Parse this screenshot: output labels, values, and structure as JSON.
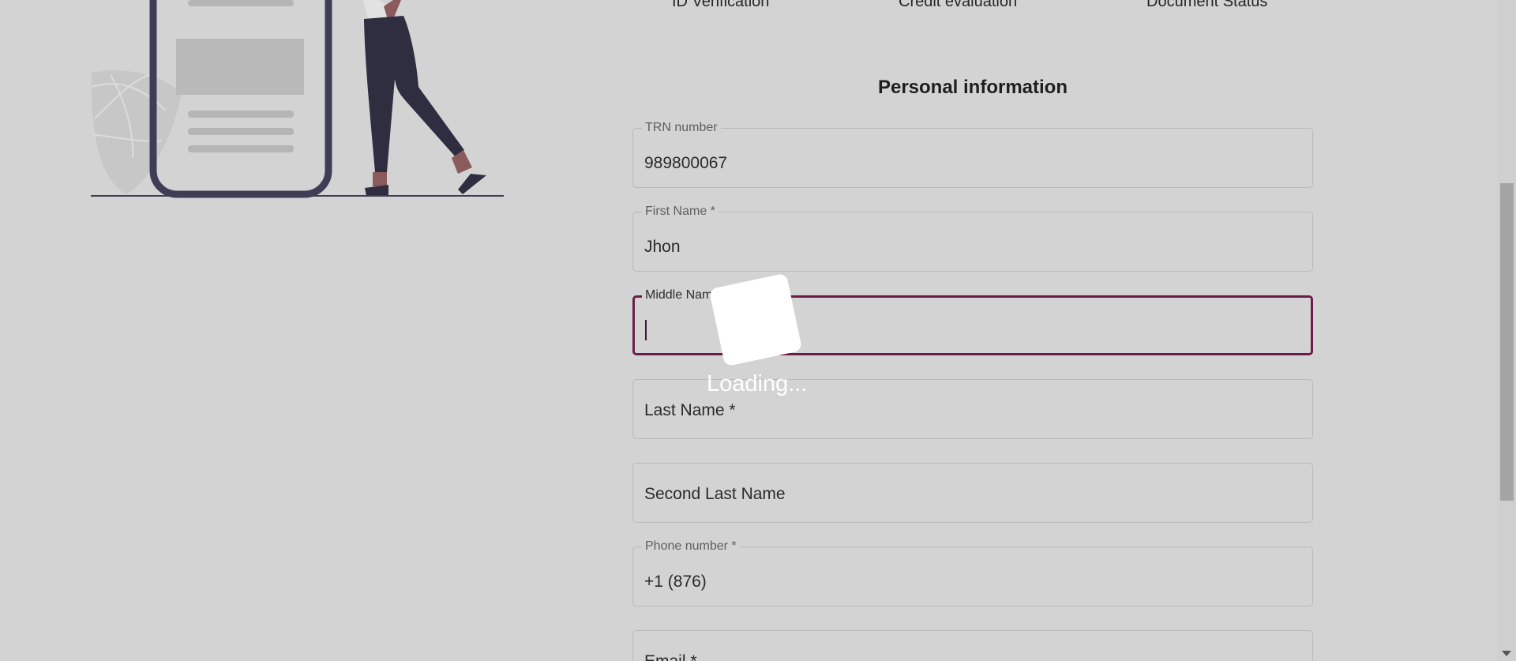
{
  "steps": {
    "id_verification": "ID Verification",
    "credit_evaluation": "Credit evaluation",
    "document_status": "Document Status"
  },
  "form": {
    "title": "Personal information",
    "trn": {
      "label": "TRN number",
      "value": "989800067"
    },
    "first_name": {
      "label": "First Name *",
      "value": "Jhon"
    },
    "middle_name": {
      "label": "Middle Name",
      "value": ""
    },
    "last_name": {
      "placeholder": "Last Name *"
    },
    "second_last_name": {
      "placeholder": "Second Last Name"
    },
    "phone": {
      "label": "Phone number *",
      "value": "+1 (876)"
    },
    "email": {
      "placeholder": "Email *"
    }
  },
  "loading": {
    "text": "Loading..."
  },
  "colors": {
    "background": "#d3d3d3",
    "focus_border": "#6b1d4a",
    "illustration_dark": "#3f3d56"
  },
  "icons": {
    "scroll_down": "chevron-down-icon"
  }
}
